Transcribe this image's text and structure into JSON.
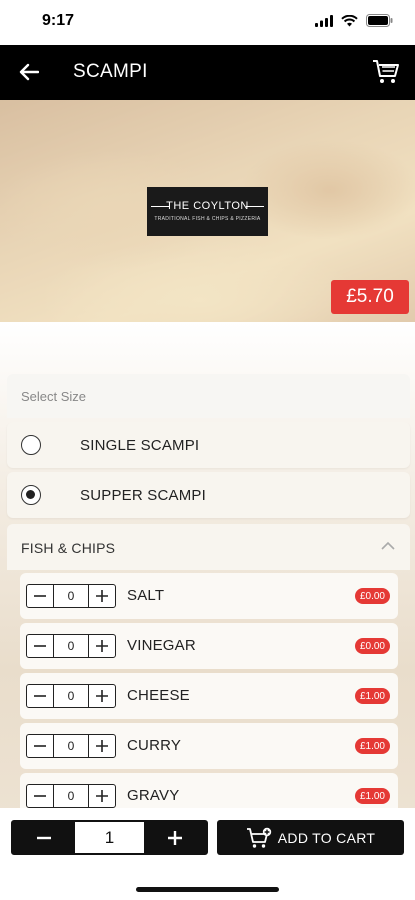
{
  "status_bar": {
    "time": "9:17"
  },
  "header": {
    "title": "SCAMPI",
    "back_icon": "arrow-left-icon",
    "cart_icon": "cart-icon"
  },
  "hero": {
    "logo_title": "THE COYLTON",
    "logo_subtitle": "TRADITIONAL FISH & CHIPS & PIZZERIA",
    "price": "£5.70"
  },
  "size": {
    "label": "Select Size",
    "options": [
      {
        "label": "SINGLE SCAMPI",
        "selected": false
      },
      {
        "label": "SUPPER SCAMPI",
        "selected": true
      }
    ]
  },
  "addons": {
    "group_title": "FISH & CHIPS",
    "expanded": true,
    "items": [
      {
        "name": "SALT",
        "qty": "0",
        "price": "£0.00"
      },
      {
        "name": "VINEGAR",
        "qty": "0",
        "price": "£0.00"
      },
      {
        "name": "CHEESE",
        "qty": "0",
        "price": "£1.00"
      },
      {
        "name": "CURRY",
        "qty": "0",
        "price": "£1.00"
      },
      {
        "name": "GRAVY",
        "qty": "0",
        "price": "£1.00"
      }
    ]
  },
  "footer": {
    "quantity": "1",
    "add_to_cart": "ADD TO CART"
  },
  "colors": {
    "accent": "#e53935",
    "bar": "#000000"
  }
}
